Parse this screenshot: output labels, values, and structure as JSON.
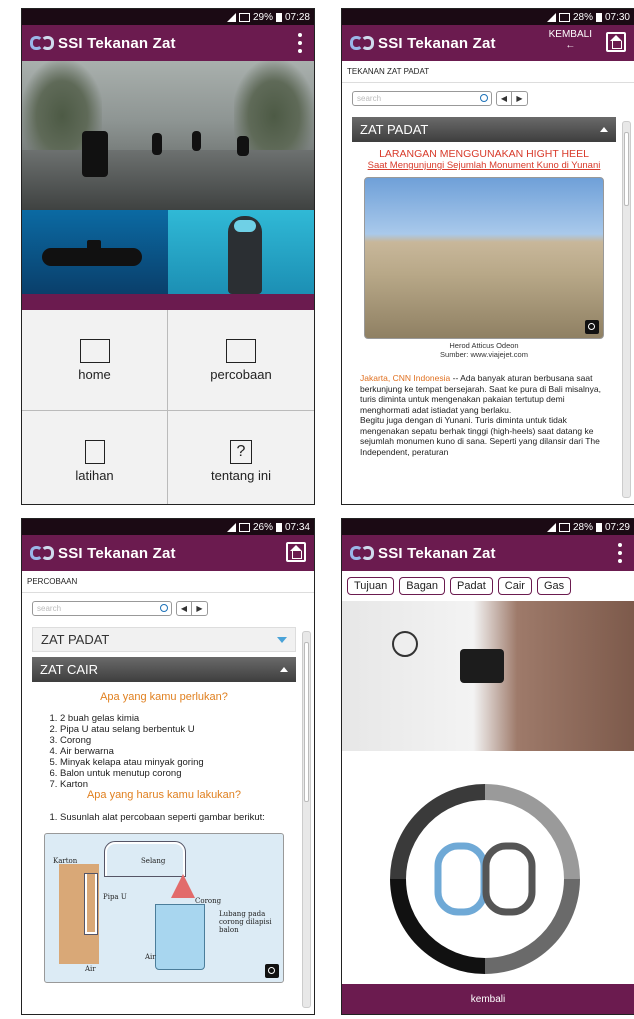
{
  "status": {
    "s1": {
      "battery": "29%",
      "time": "07:28"
    },
    "s2": {
      "battery": "28%",
      "time": "07:30"
    },
    "s3": {
      "battery": "26%",
      "time": "07:34"
    },
    "s4": {
      "battery": "28%",
      "time": "07:29"
    }
  },
  "app": {
    "title": "SSI Tekanan Zat"
  },
  "home": {
    "menu": [
      {
        "label": "home"
      },
      {
        "label": "percobaan"
      },
      {
        "label": "latihan"
      },
      {
        "label": "tentang ini"
      }
    ]
  },
  "article_screen": {
    "back_label": "KEMBALI",
    "breadcrumb": "TEKANAN ZAT PADAT",
    "search_placeholder": "search",
    "section": "ZAT PADAT",
    "title": "LARANGAN MENGGUNAKAN HIGHT HEEL",
    "subtitle": "Saat Mengunjungi Sejumlah Monument Kuno di Yunani",
    "caption_1": "Herod Atticus Odeon",
    "caption_2": "Sumber: www.viajejet.com",
    "lead": "Jakarta, CNN Indonesia",
    "body": "-- Ada banyak aturan berbusana saat berkunjung ke tempat bersejarah. Saat ke pura di Bali misalnya, turis diminta untuk mengenakan pakaian tertutup demi menghormati adat istiadat yang berlaku.",
    "body_2": "Begitu juga dengan di Yunani. Turis diminta untuk tidak mengenakan sepatu berhak tinggi (high-heels) saat datang ke sejumlah monumen kuno di sana. Seperti yang dilansir dari The Independent, peraturan"
  },
  "experiment_screen": {
    "breadcrumb": "PERCOBAAN",
    "search_placeholder": "search",
    "section_1": "ZAT PADAT",
    "section_2": "ZAT CAIR",
    "needs_heading": "Apa yang kamu perlukan?",
    "needs": [
      "2 buah gelas kimia",
      "Pipa U atau selang berbentuk U",
      "Corong",
      "Air berwarna",
      "Minyak kelapa atau minyak goring",
      "Balon untuk menutup corong",
      "Karton"
    ],
    "todo_heading": "Apa yang harus kamu lakukan?",
    "steps": [
      "Susunlah alat percobaan seperti gambar berikut:"
    ],
    "diagram_labels": {
      "karton": "Karton",
      "selang": "Selang",
      "pipa": "Pipa U",
      "corong": "Corong",
      "lubang": "Lubang pada corong dilapisi balon",
      "air_1": "Air",
      "air_2": "Air"
    }
  },
  "topics_screen": {
    "chips": [
      "Tujuan",
      "Bagan",
      "Padat",
      "Cair",
      "Gas"
    ],
    "back_label": "kembali"
  }
}
